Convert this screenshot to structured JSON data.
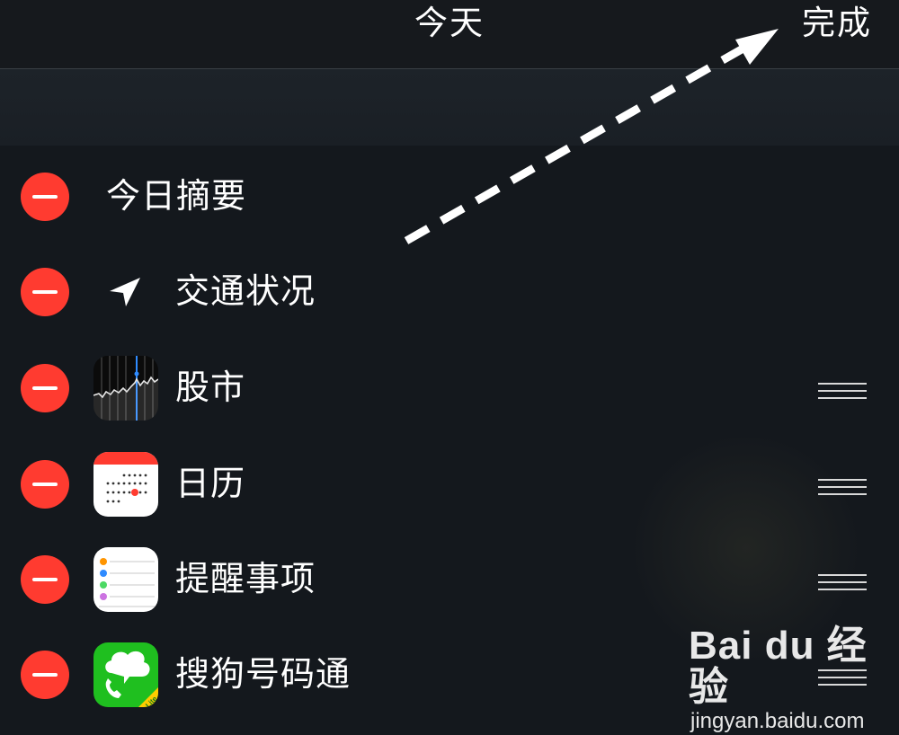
{
  "header": {
    "title": "今天",
    "done_label": "完成"
  },
  "widgets": [
    {
      "label": "今日摘要",
      "icon": "none"
    },
    {
      "label": "交通状况",
      "icon": "location-arrow-icon"
    },
    {
      "label": "股市",
      "icon": "stocks-app-icon",
      "reorderable": true
    },
    {
      "label": "日历",
      "icon": "calendar-app-icon",
      "reorderable": true
    },
    {
      "label": "提醒事项",
      "icon": "reminders-app-icon",
      "reorderable": true
    },
    {
      "label": "搜狗号码通",
      "icon": "sogou-haomatong-app-icon",
      "reorderable": true,
      "icon_badge": "Lite"
    }
  ],
  "watermark": {
    "brand": "Bai du 经验",
    "url": "jingyan.baidu.com"
  },
  "colors": {
    "background": "#14181d",
    "delete_red": "#ff3b30",
    "sogou_green": "#1fbf1f"
  }
}
